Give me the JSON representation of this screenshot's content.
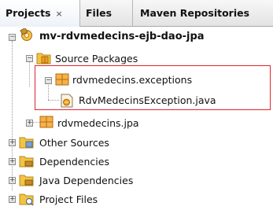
{
  "tabs": [
    {
      "label": "Projects",
      "close": "×",
      "active": true
    },
    {
      "label": "Files",
      "active": false
    },
    {
      "label": "Maven Repositories",
      "active": false
    }
  ],
  "tree": {
    "project": "mv-rdvmedecins-ejb-dao-jpa",
    "source_packages": "Source Packages",
    "pkg_exceptions": "rdvmedecins.exceptions",
    "file_exception": "RdvMedecinsException.java",
    "pkg_jpa": "rdvmedecins.jpa",
    "other_sources": "Other Sources",
    "dependencies": "Dependencies",
    "java_dependencies": "Java Dependencies",
    "project_files": "Project Files"
  },
  "colors": {
    "highlight_border": "#e0262b",
    "package_icon": "#f0a020",
    "folder_icon": "#f3c442"
  }
}
